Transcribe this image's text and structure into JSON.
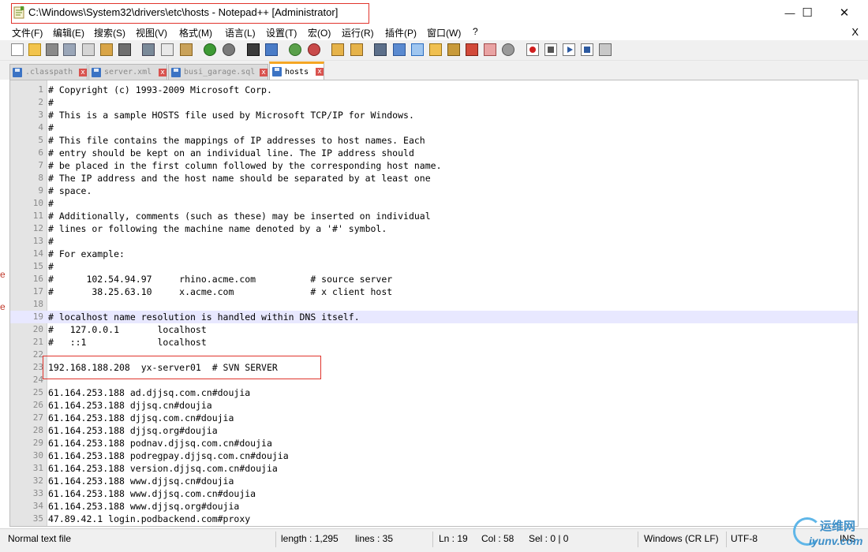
{
  "window": {
    "title": "C:\\Windows\\System32\\drivers\\etc\\hosts - Notepad++ [Administrator]",
    "minimize_glyph": "—",
    "maximize_glyph": "☐",
    "close_glyph": "✕"
  },
  "menu": {
    "items": [
      "文件(F)",
      "编辑(E)",
      "搜索(S)",
      "视图(V)",
      "格式(M)",
      "语言(L)",
      "设置(T)",
      "宏(O)",
      "运行(R)",
      "插件(P)",
      "窗口(W)",
      "?"
    ],
    "close_label": "X"
  },
  "tabs": [
    {
      "label": ".classpath",
      "active": false
    },
    {
      "label": "server.xml",
      "active": false
    },
    {
      "label": "busi_garage.sql",
      "active": false
    },
    {
      "label": "hosts",
      "active": true
    }
  ],
  "tab_close_glyph": "x",
  "editor": {
    "current_line": 19,
    "lines": [
      "# Copyright (c) 1993-2009 Microsoft Corp.",
      "#",
      "# This is a sample HOSTS file used by Microsoft TCP/IP for Windows.",
      "#",
      "# This file contains the mappings of IP addresses to host names. Each",
      "# entry should be kept on an individual line. The IP address should",
      "# be placed in the first column followed by the corresponding host name.",
      "# The IP address and the host name should be separated by at least one",
      "# space.",
      "#",
      "# Additionally, comments (such as these) may be inserted on individual",
      "# lines or following the machine name denoted by a '#' symbol.",
      "#",
      "# For example:",
      "#",
      "#      102.54.94.97     rhino.acme.com          # source server",
      "#       38.25.63.10     x.acme.com              # x client host",
      "",
      "# localhost name resolution is handled within DNS itself.",
      "#   127.0.0.1       localhost",
      "#   ::1             localhost",
      "",
      "192.168.188.208  yx-server01  # SVN SERVER",
      "",
      "61.164.253.188 ad.djjsq.com.cn#doujia",
      "61.164.253.188 djjsq.cn#doujia",
      "61.164.253.188 djjsq.com.cn#doujia",
      "61.164.253.188 djjsq.org#doujia",
      "61.164.253.188 podnav.djjsq.com.cn#doujia",
      "61.164.253.188 podregpay.djjsq.com.cn#doujia",
      "61.164.253.188 version.djjsq.com.cn#doujia",
      "61.164.253.188 www.djjsq.cn#doujia",
      "61.164.253.188 www.djjsq.com.cn#doujia",
      "61.164.253.188 www.djjsq.org#doujia",
      "47.89.42.1 login.podbackend.com#proxy"
    ]
  },
  "status": {
    "file_type": "Normal text file",
    "length": "length : 1,295",
    "lines": "lines : 35",
    "ln": "Ln : 19",
    "col": "Col : 58",
    "sel": "Sel : 0 | 0",
    "eol": "Windows (CR LF)",
    "encoding": "UTF-8",
    "mode": "INS"
  },
  "watermark": {
    "cn": "运维网",
    "en": "iyunv.com"
  },
  "edge_marks": [
    "e",
    "e"
  ],
  "colors": {
    "highlight_box": "#e0342c",
    "current_line": "#e8e8ff",
    "active_tab_accent": "#f5a623"
  }
}
